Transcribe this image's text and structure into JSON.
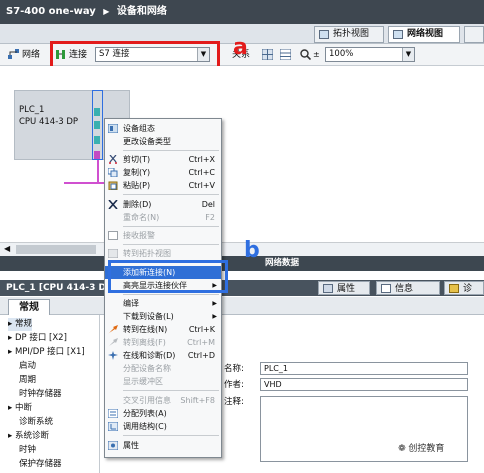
{
  "title": {
    "project": "S7-400 one-way",
    "crumb": "设备和网络"
  },
  "view_tabs": {
    "topology": "拓扑视图",
    "network": "网络视图",
    "device": ""
  },
  "toolbar": {
    "network_label": "网络",
    "connect_label": "连接",
    "connection_type": "S7 连接",
    "relation_label": "关系",
    "zoom_value": "100%"
  },
  "annotations": {
    "a": "a",
    "b": "b"
  },
  "device": {
    "name": "PLC_1",
    "type": "CPU 414-3 DP"
  },
  "net_data_bar": "网络数据",
  "properties": {
    "title": "PLC_1 [CPU 414-3 D",
    "tabs": {
      "props": "属性",
      "info": "信息",
      "diag": "诊断"
    },
    "subtab": "常规"
  },
  "nav_items": [
    "常规",
    "DP 接口 [X2]",
    "MPI/DP 接口 [X1]",
    "启动",
    "周期",
    "时钟存储器",
    "中断",
    "诊断系统",
    "系统诊断",
    "时钟",
    "保护存储器"
  ],
  "form": {
    "name_label": "名称:",
    "name_value": "PLC_1",
    "author_label": "作者:",
    "author_value": "VHD",
    "comment_label": "注释:"
  },
  "context_menu": {
    "items": [
      {
        "label": "设备组态",
        "shortcut": "",
        "icon": "device-config-icon"
      },
      {
        "label": "更改设备类型",
        "shortcut": "",
        "icon": ""
      },
      {
        "label": "剪切(T)",
        "shortcut": "Ctrl+X",
        "icon": "scissors-icon"
      },
      {
        "label": "复制(Y)",
        "shortcut": "Ctrl+C",
        "icon": "copy-icon"
      },
      {
        "label": "粘贴(P)",
        "shortcut": "Ctrl+V",
        "icon": "paste-icon"
      },
      {
        "label": "删除(D)",
        "shortcut": "Del",
        "icon": "delete-icon"
      },
      {
        "label": "重命名(N)",
        "shortcut": "F2",
        "icon": ""
      },
      {
        "label": "接收报警",
        "shortcut": "",
        "icon": "checkbox-icon"
      },
      {
        "label": "转到拓扑视图",
        "shortcut": "",
        "icon": "topology-icon"
      },
      {
        "label": "添加新连接(N)",
        "shortcut": "",
        "icon": ""
      },
      {
        "label": "高亮显示连接伙伴",
        "shortcut": "",
        "icon": ""
      },
      {
        "label": "编译",
        "shortcut": "",
        "icon": ""
      },
      {
        "label": "下载到设备(L)",
        "shortcut": "",
        "icon": ""
      },
      {
        "label": "转到在线(N)",
        "shortcut": "Ctrl+K",
        "icon": "go-online-icon"
      },
      {
        "label": "转到离线(F)",
        "shortcut": "Ctrl+M",
        "icon": "go-offline-icon"
      },
      {
        "label": "在线和诊断(D)",
        "shortcut": "Ctrl+D",
        "icon": "diagnostics-icon"
      },
      {
        "label": "分配设备名称",
        "shortcut": "",
        "icon": ""
      },
      {
        "label": "显示缓冲区",
        "shortcut": "",
        "icon": ""
      },
      {
        "label": "交叉引用信息",
        "shortcut": "Shift+F8",
        "icon": ""
      },
      {
        "label": "分配列表(A)",
        "shortcut": "",
        "icon": "list-icon"
      },
      {
        "label": "调用结构(C)",
        "shortcut": "",
        "icon": "call-structure-icon"
      },
      {
        "label": "属性",
        "shortcut": "",
        "icon": "properties-icon"
      }
    ]
  },
  "watermark": "创控教育",
  "colors": {
    "annotation_red": "#e21b1b",
    "annotation_blue": "#2f6fe0",
    "menu_highlight": "#2f6fd6",
    "title_bar": "#3e4750"
  }
}
